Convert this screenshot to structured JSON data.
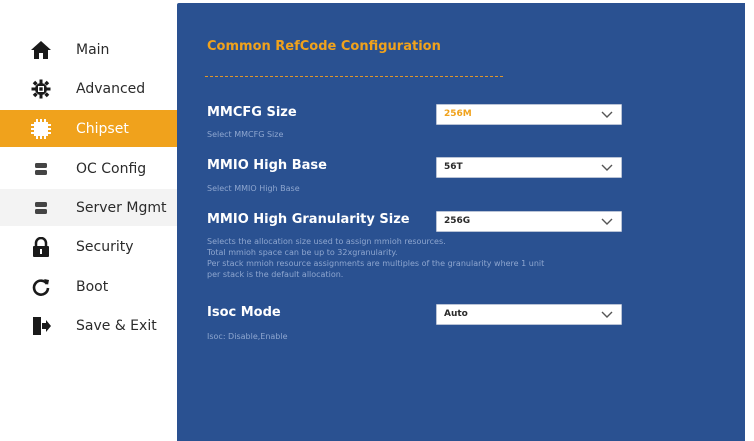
{
  "sidebar": {
    "items": [
      {
        "label": "Main",
        "icon": "home-icon"
      },
      {
        "label": "Advanced",
        "icon": "gear-icon"
      },
      {
        "label": "Chipset",
        "icon": "chip-icon",
        "active": true
      },
      {
        "label": "OC Config",
        "icon": "server-icon"
      },
      {
        "label": "Server Mgmt",
        "icon": "server-icon"
      },
      {
        "label": "Security",
        "icon": "lock-icon"
      },
      {
        "label": "Boot",
        "icon": "refresh-icon"
      },
      {
        "label": "Save & Exit",
        "icon": "exit-icon"
      }
    ]
  },
  "main": {
    "title": "Common RefCode Configuration",
    "settings": [
      {
        "label": "MMCFG Size",
        "value": "256M",
        "help": [
          "Select MMCFG Size"
        ]
      },
      {
        "label": "MMIO High Base",
        "value": "56T",
        "help": [
          "Select MMIO High Base"
        ]
      },
      {
        "label": "MMIO High Granularity Size",
        "value": "256G",
        "help": [
          "Selects the allocation size used to assign mmioh resources.",
          "Total mmioh space can be up to 32xgranularity.",
          "Per stack mmioh resource assignments are multiples of the granularity where 1 unit",
          "per stack is the default allocation."
        ]
      },
      {
        "label": "Isoc Mode",
        "value": "Auto",
        "help": [
          "Isoc: Disable,Enable"
        ]
      }
    ]
  },
  "colors": {
    "accent": "#f0a21c",
    "panel": "#2a5191",
    "help_text": "#8ea6cf"
  }
}
